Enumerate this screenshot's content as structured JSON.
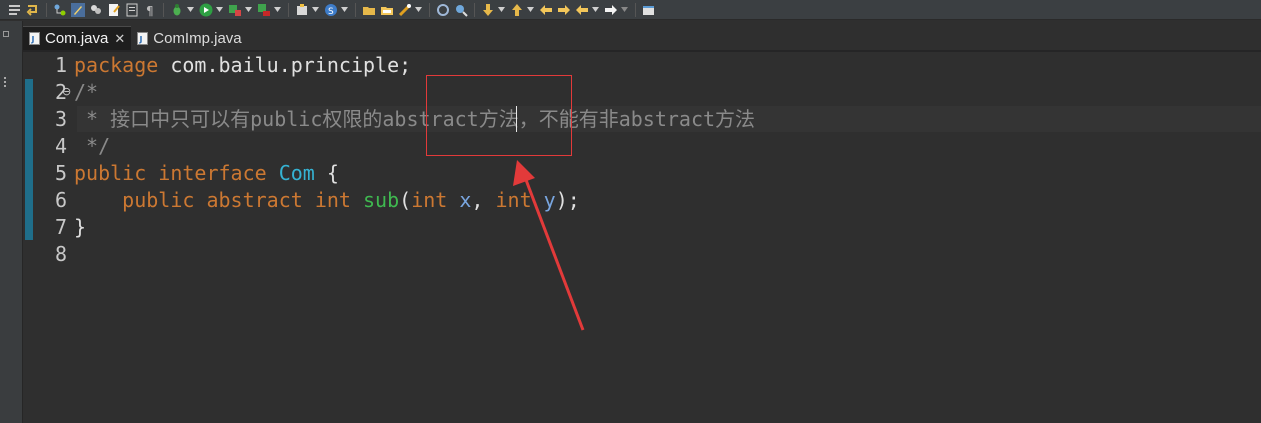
{
  "toolbar": {
    "icons": [
      "list-icon",
      "arrow-return-icon",
      "flow-icon",
      "brush-icon",
      "people-icon",
      "doc-edit-icon",
      "page-icon",
      "pilcrow-icon",
      "bug-icon",
      "run-icon",
      "build-icon",
      "tool-icon",
      "package-icon",
      "globe-icon",
      "folder-open-icon",
      "folder-icon",
      "wand-icon",
      "refresh-icon",
      "search-icon",
      "down-arrow-icon",
      "up-arrow-icon",
      "back-icon",
      "forward-icon",
      "left-icon",
      "right-icon",
      "new-window-icon"
    ],
    "accent": "#3b3f42"
  },
  "tabs": [
    {
      "label": "Com.java",
      "active": true,
      "close": "✕"
    },
    {
      "label": "ComImp.java",
      "active": false
    }
  ],
  "editor": {
    "lines": [
      {
        "n": "1"
      },
      {
        "n": "2",
        "fold": "⊖"
      },
      {
        "n": "3"
      },
      {
        "n": "4"
      },
      {
        "n": "5"
      },
      {
        "n": "6"
      },
      {
        "n": "7"
      },
      {
        "n": "8"
      }
    ],
    "code": {
      "l1_kw": "package",
      "l1_rest": " com.bailu.principle;",
      "l2": "/*",
      "l3": " * 接口中只可以有public权限的abstract方法，不能有非abstract方法",
      "l4": " */",
      "l5_kw1": "public",
      "l5_kw2": "interface",
      "l5_type": "Com",
      "l5_rest": " {",
      "l6_indent": "    ",
      "l6_kw1": "public",
      "l6_kw2": "abstract",
      "l6_kw3": "int",
      "l6_meth": "sub",
      "l6_p1": "(",
      "l6_kw4": "int",
      "l6_x": "x",
      "l6_comma": ", ",
      "l6_kw5": "int",
      "l6_y": "y",
      "l6_end": ");",
      "l7": "}"
    },
    "colors": {
      "keyword": "#cc7832",
      "comment": "#8a8a8a",
      "type": "#35b3d3",
      "method": "#3fb950",
      "param": "#79a6e0",
      "annotation": "#e23a3a"
    }
  }
}
